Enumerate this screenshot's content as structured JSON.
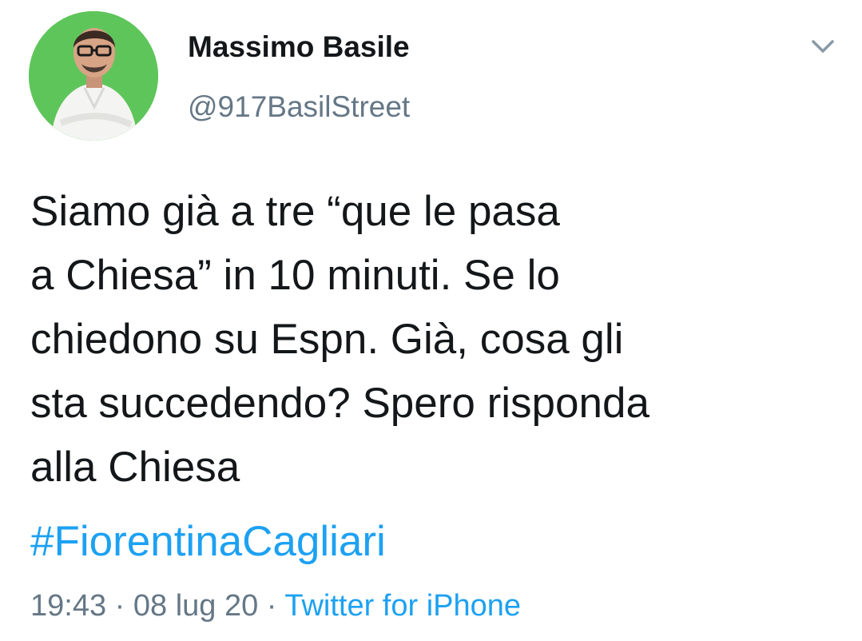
{
  "author": {
    "name": "Massimo Basile",
    "handle": "@917BasilStreet",
    "avatar_bg": "#5ec55a"
  },
  "tweet": {
    "text": "Siamo già a tre “que le pasa\na Chiesa” in 10 minuti. Se lo\nchiedono su Espn. Già, cosa gli\nsta succedendo? Spero risponda\nalla Chiesa",
    "hashtag": "#FiorentinaCagliari",
    "time": "19:43",
    "separator": " · ",
    "date": "08 lug 20",
    "source": "Twitter for iPhone"
  },
  "icons": {
    "menu": "chevron-down-icon"
  },
  "colors": {
    "text": "#14171a",
    "secondary": "#657786",
    "link": "#1da1f2",
    "background": "#ffffff"
  }
}
